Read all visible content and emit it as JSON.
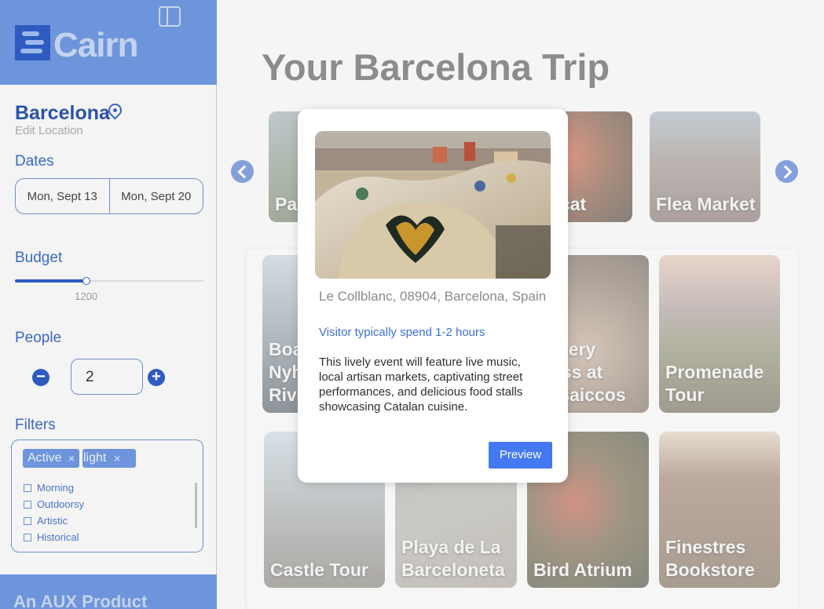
{
  "app": {
    "name": "Cairn",
    "footer_text": "An AUX Product"
  },
  "sidebar": {
    "location": {
      "city": "Barcelona",
      "edit_label": "Edit Location"
    },
    "dates": {
      "label": "Dates",
      "start": "Mon, Sept 13",
      "end": "Mon, Sept 20"
    },
    "budget": {
      "label": "Budget",
      "value": "1200",
      "fill_fraction": 0.38
    },
    "people": {
      "label": "People",
      "value": "2"
    },
    "filters": {
      "label": "Filters",
      "chips": [
        {
          "label": "Active",
          "remove": "×"
        },
        {
          "label": "light",
          "remove": "×"
        }
      ],
      "options": [
        "Morning",
        "Outdoorsy",
        "Artistic",
        "Historical"
      ]
    }
  },
  "main": {
    "title": "Your Barcelona Trip",
    "carousel": [
      {
        "label": "Park Güell"
      },
      {
        "label": "Mercat"
      },
      {
        "label": "Flea Market"
      }
    ],
    "grid": [
      {
        "label": "Boat the Nyhavn River"
      },
      {
        "label": "Pottery Class at Mosaiccos"
      },
      {
        "label": "Promenade Tour"
      },
      {
        "label": "Castle Tour"
      },
      {
        "label": "Playa de La Barceloneta"
      },
      {
        "label": "Bird Atrium"
      },
      {
        "label": "Finestres Bookstore"
      }
    ]
  },
  "modal": {
    "address": "Le Collblanc, 08904, Barcelona, Spain",
    "visit_time": "Visitor typically spend 1-2 hours",
    "description": "This lively event will feature live music, local artisan markets, captivating street performances, and delicious food stalls showcasing Catalan cuisine.",
    "button_label": "Preview"
  }
}
